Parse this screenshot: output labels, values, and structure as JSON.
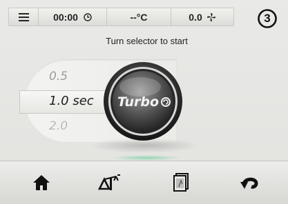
{
  "statusbar": {
    "time": "00:00",
    "temperature": "--°C",
    "fan_value": "0.0"
  },
  "step_number": "3",
  "instruction": "Turn selector to start",
  "selector": {
    "options": [
      "0.5",
      "1.0 sec",
      "2.0"
    ],
    "selected_index": 1
  },
  "knob": {
    "label": "Turbo"
  },
  "toolbar": {
    "items": [
      {
        "icon": "home-icon"
      },
      {
        "icon": "scale-icon"
      },
      {
        "icon": "recipe-book-icon"
      },
      {
        "icon": "back-icon"
      }
    ]
  },
  "colors": {
    "knob_ring": "#2b2b2b",
    "accent_glow": "#50c88c"
  }
}
